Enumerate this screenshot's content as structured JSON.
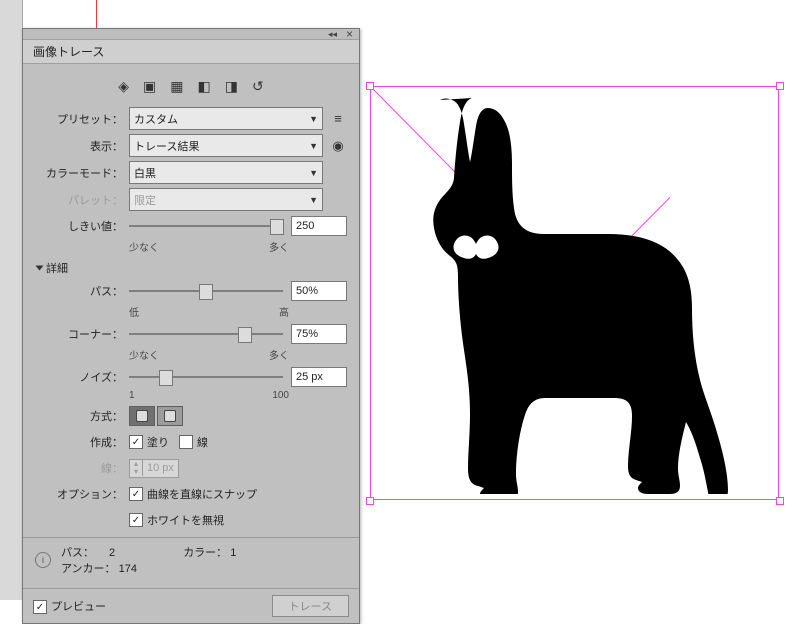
{
  "panel": {
    "title": "画像トレース",
    "presetLabel": "プリセット：",
    "presetValue": "カスタム",
    "viewLabel": "表示：",
    "viewValue": "トレース結果",
    "modeLabel": "カラーモード：",
    "modeValue": "白黒",
    "paletteLabel": "パレット：",
    "paletteValue": "限定",
    "thresholdLabel": "しきい値：",
    "thresholdValue": "250",
    "thresholdMin": "少なく",
    "thresholdMax": "多く",
    "detailsLabel": "詳細",
    "pathLabel": "パス：",
    "pathValue": "50%",
    "pathMin": "低",
    "pathMax": "高",
    "cornerLabel": "コーナー：",
    "cornerValue": "75%",
    "cornerMin": "少なく",
    "cornerMax": "多く",
    "noiseLabel": "ノイズ：",
    "noiseValue": "25 px",
    "noiseMin": "1",
    "noiseMax": "100",
    "methodLabel": "方式：",
    "createLabel": "作成：",
    "createFill": "塗り",
    "createStroke": "線",
    "strokeLabel": "線：",
    "strokeValue": "10 px",
    "optionLabel": "オプション：",
    "optionSnap": "曲線を直線にスナップ",
    "optionIgnoreWhite": "ホワイトを無視",
    "statPathsLabel": "パス：",
    "statPathsValue": "2",
    "statColorsLabel": "カラー：",
    "statColorsValue": "1",
    "statAnchorsLabel": "アンカー：",
    "statAnchorsValue": "174",
    "previewLabel": "プレビュー",
    "traceButton": "トレース"
  }
}
